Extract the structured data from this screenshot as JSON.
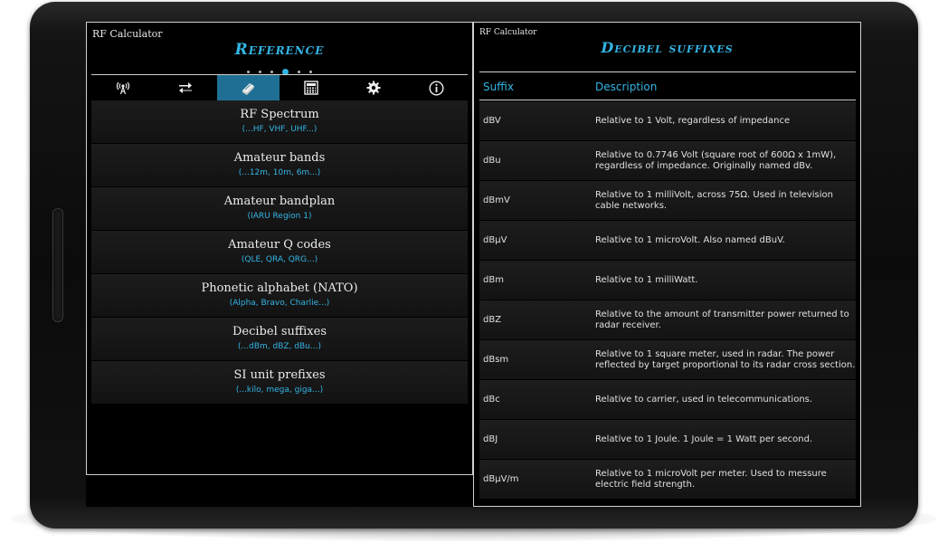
{
  "left": {
    "app_title": "RF Calculator",
    "page_title": "Reference",
    "tabs": [
      {
        "icon": "antenna-icon"
      },
      {
        "icon": "swap-arrows-icon"
      },
      {
        "icon": "book-icon",
        "active": true
      },
      {
        "icon": "calculator-icon"
      },
      {
        "icon": "gear-icon"
      },
      {
        "icon": "info-icon"
      }
    ],
    "menu": [
      {
        "title": "RF Spectrum",
        "sub": "(...HF, VHF, UHF...)"
      },
      {
        "title": "Amateur bands",
        "sub": "(...12m, 10m, 6m...)"
      },
      {
        "title": "Amateur bandplan",
        "sub": "(IARU Region 1)"
      },
      {
        "title": "Amateur Q codes",
        "sub": "(QLE, QRA, QRG...)"
      },
      {
        "title": "Phonetic alphabet (NATO)",
        "sub": "(Alpha, Bravo, Charlie...)"
      },
      {
        "title": "Decibel suffixes",
        "sub": "(...dBm, dBZ, dBu...)"
      },
      {
        "title": "SI unit prefixes",
        "sub": "(...kilo, mega, giga...)"
      }
    ]
  },
  "right": {
    "app_title": "RF Calculator",
    "page_title": "Decibel suffixes",
    "headers": {
      "suffix": "Suffix",
      "description": "Description"
    },
    "rows": [
      {
        "suffix": "dBV",
        "description": "Relative to 1 Volt, regardless of impedance"
      },
      {
        "suffix": "dBu",
        "description": "Relative to 0.7746 Volt (square root of 600Ω x 1mW), regardless of impedance. Originally named dBv."
      },
      {
        "suffix": "dBmV",
        "description": "Relative to 1 milliVolt, across 75Ω. Used in television cable networks."
      },
      {
        "suffix": "dBµV",
        "description": "Relative to 1 microVolt. Also named dBuV."
      },
      {
        "suffix": "dBm",
        "description": "Relative to 1 milliWatt."
      },
      {
        "suffix": "dBZ",
        "description": "Relative to the amount of transmitter power returned to radar receiver."
      },
      {
        "suffix": "dBsm",
        "description": "Relative to 1 square meter, used in radar. The power reflected by target proportional to its radar cross section."
      },
      {
        "suffix": "dBc",
        "description": "Relative to carrier, used in telecommunications."
      },
      {
        "suffix": "dBJ",
        "description": "Relative to 1 Joule. 1 Joule = 1 Watt per second."
      },
      {
        "suffix": "dBµV/m",
        "description": "Relative to 1 microVolt per meter. Used to messure electric field strength."
      }
    ]
  },
  "colors": {
    "accent": "#33b5e5",
    "tab_active": "#1f6f94"
  }
}
